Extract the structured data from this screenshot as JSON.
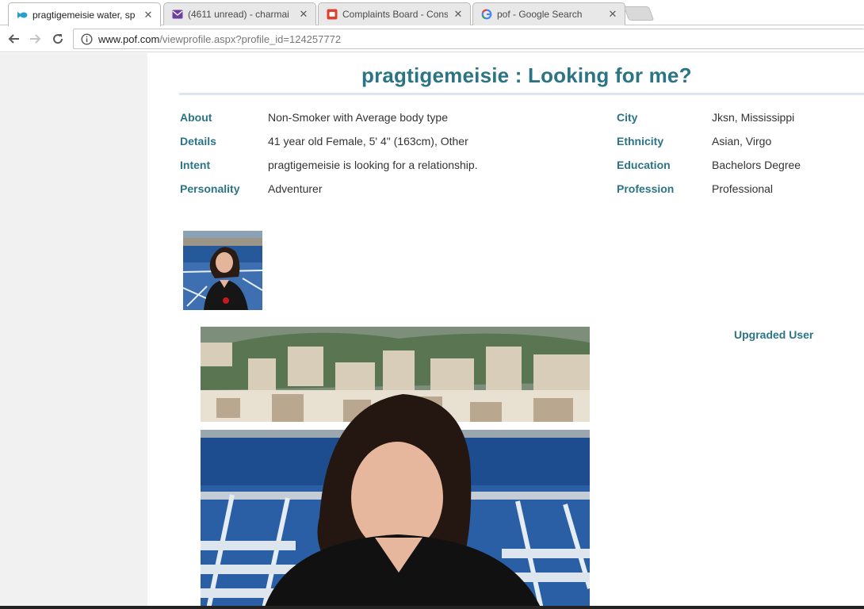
{
  "browser": {
    "tabs": [
      {
        "title": "pragtigemeisie water, sp",
        "favicon": "fish-icon",
        "active": true
      },
      {
        "title": "(4611 unread) - charmai",
        "favicon": "mail-icon",
        "active": false
      },
      {
        "title": "Complaints Board - Cons",
        "favicon": "complaints-icon",
        "active": false
      },
      {
        "title": "pof - Google Search",
        "favicon": "google-icon",
        "active": false
      }
    ],
    "close_glyph": "✕",
    "url_host": "www.pof.com",
    "url_path": "/viewprofile.aspx?profile_id=124257772"
  },
  "profile": {
    "heading": "pragtigemeisie : Looking for me?",
    "left_fields": [
      {
        "label": "About",
        "value": "Non-Smoker with Average body type"
      },
      {
        "label": "Details",
        "value": "41 year old Female, 5' 4\" (163cm), Other"
      },
      {
        "label": "Intent",
        "value": "pragtigemeisie is looking for a relationship."
      },
      {
        "label": "Personality",
        "value": "Adventurer"
      }
    ],
    "right_fields": [
      {
        "label": "City",
        "value": "Jksn, Mississippi"
      },
      {
        "label": "Ethnicity",
        "value": "Asian, Virgo"
      },
      {
        "label": "Education",
        "value": "Bachelors Degree"
      },
      {
        "label": "Profession",
        "value": "Professional"
      }
    ],
    "badge": "Upgraded User"
  },
  "colors": {
    "accent": "#2b7485",
    "text": "#333333",
    "gutter": "#f1f1f1"
  }
}
